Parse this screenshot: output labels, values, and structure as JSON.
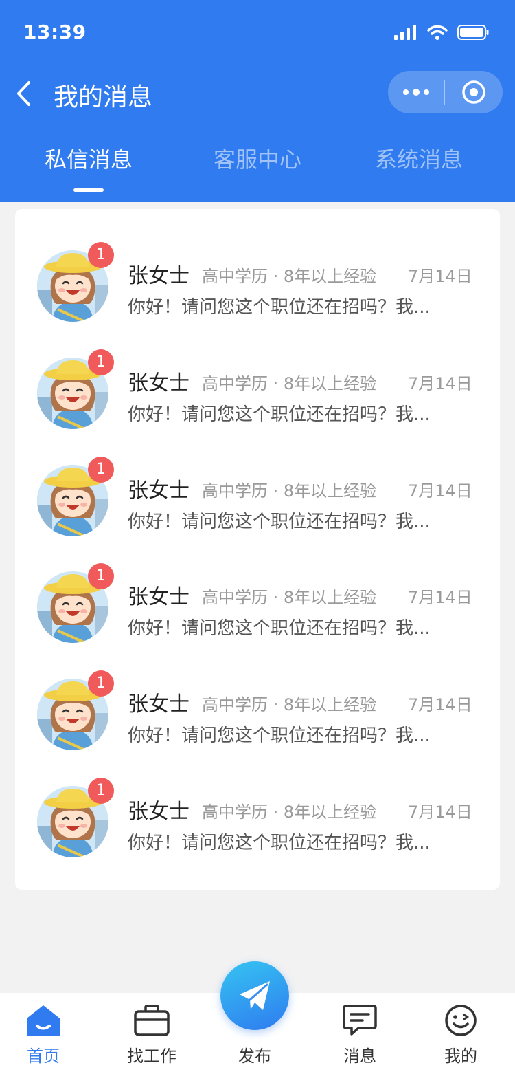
{
  "status_bar": {
    "time": "13:39"
  },
  "nav": {
    "title": "我的消息"
  },
  "tabs": [
    {
      "label": "私信消息"
    },
    {
      "label": "客服中心"
    },
    {
      "label": "系统消息"
    }
  ],
  "messages": [
    {
      "name": "张女士",
      "meta": "高中学历 · 8年以上经验",
      "date": "7月14日",
      "preview": "你好！请问您这个职位还在招吗？我...",
      "badge": "1"
    },
    {
      "name": "张女士",
      "meta": "高中学历 · 8年以上经验",
      "date": "7月14日",
      "preview": "你好！请问您这个职位还在招吗？我...",
      "badge": "1"
    },
    {
      "name": "张女士",
      "meta": "高中学历 · 8年以上经验",
      "date": "7月14日",
      "preview": "你好！请问您这个职位还在招吗？我...",
      "badge": "1"
    },
    {
      "name": "张女士",
      "meta": "高中学历 · 8年以上经验",
      "date": "7月14日",
      "preview": "你好！请问您这个职位还在招吗？我...",
      "badge": "1"
    },
    {
      "name": "张女士",
      "meta": "高中学历 · 8年以上经验",
      "date": "7月14日",
      "preview": "你好！请问您这个职位还在招吗？我...",
      "badge": "1"
    },
    {
      "name": "张女士",
      "meta": "高中学历 · 8年以上经验",
      "date": "7月14日",
      "preview": "你好！请问您这个职位还在招吗？我...",
      "badge": "1"
    }
  ],
  "tabbar": {
    "home": "首页",
    "jobs": "找工作",
    "publish": "发布",
    "messages": "消息",
    "mine": "我的"
  },
  "colors": {
    "primary": "#2f7bef",
    "badge": "#f05a5a",
    "page_bg": "#f2f2f2"
  }
}
